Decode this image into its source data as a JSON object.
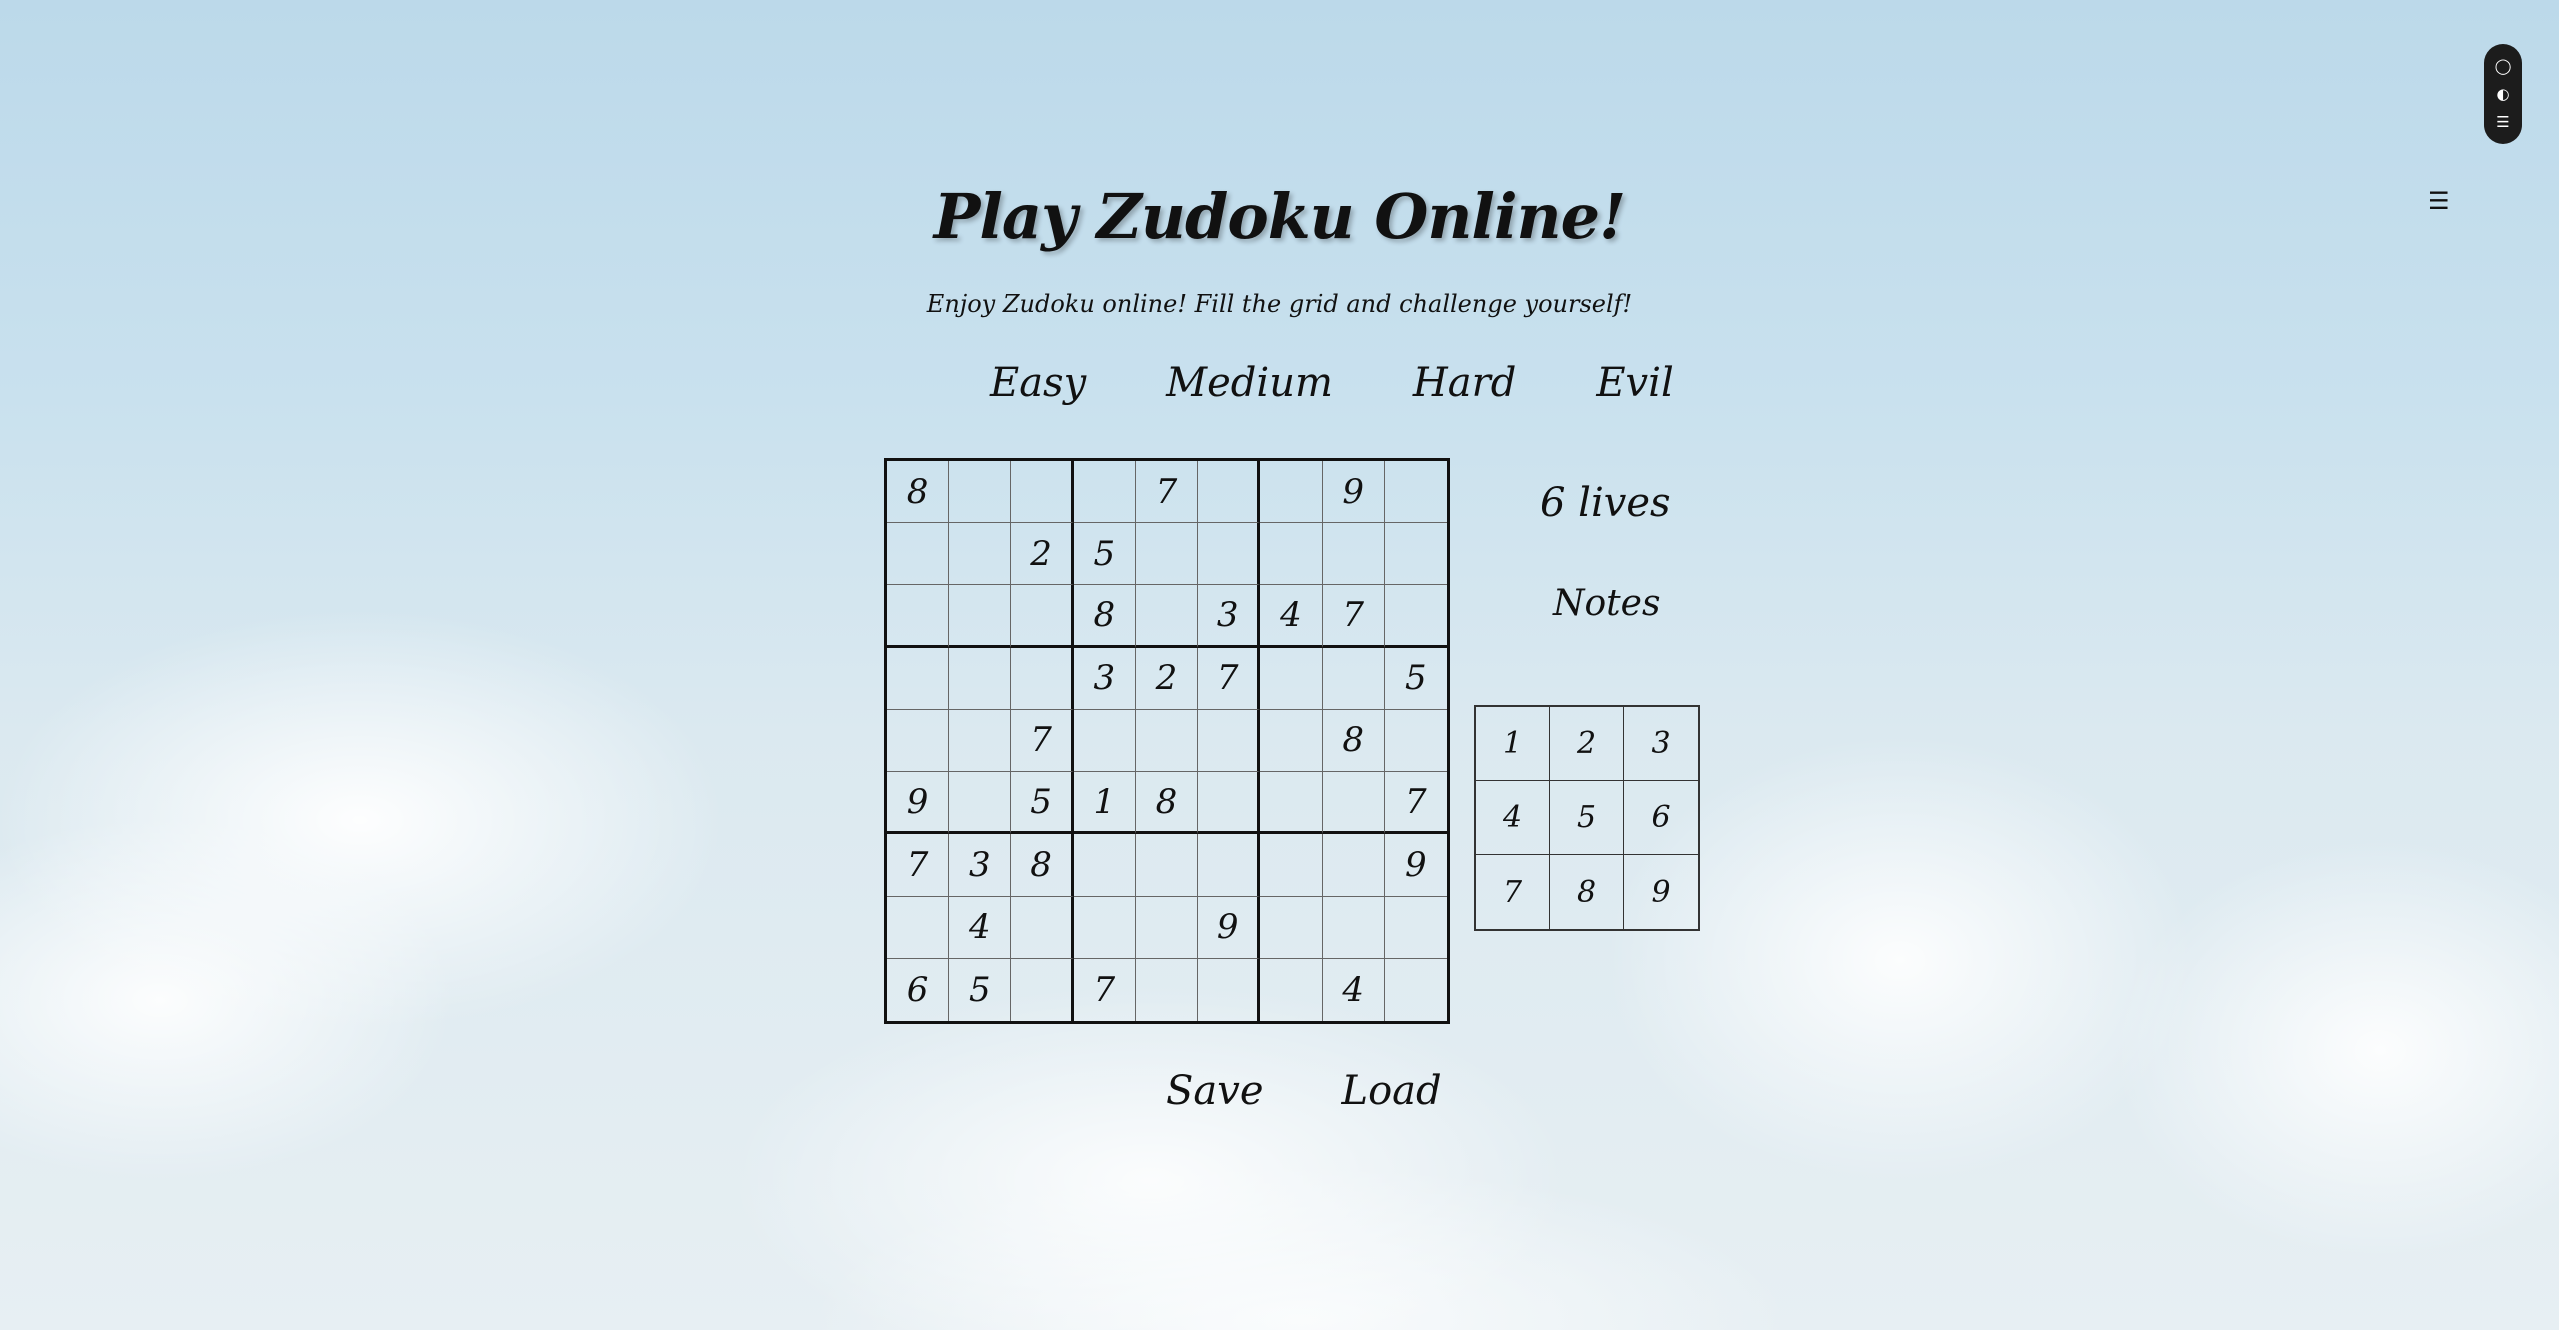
{
  "title": "Play Zudoku Online!",
  "subtitle": "Enjoy Zudoku online! Fill the grid and challenge yourself!",
  "levels": [
    "Easy",
    "Medium",
    "Hard",
    "Evil"
  ],
  "board": [
    [
      "8",
      "",
      "",
      "",
      "7",
      "",
      "",
      "9",
      ""
    ],
    [
      "",
      "",
      "2",
      "5",
      "",
      "",
      "",
      "",
      ""
    ],
    [
      "",
      "",
      "",
      "8",
      "",
      "3",
      "4",
      "7",
      ""
    ],
    [
      "",
      "",
      "",
      "3",
      "2",
      "7",
      "",
      "",
      "5"
    ],
    [
      "",
      "",
      "7",
      "",
      "",
      "",
      "",
      "8",
      ""
    ],
    [
      "9",
      "",
      "5",
      "1",
      "8",
      "",
      "",
      "",
      "7"
    ],
    [
      "7",
      "3",
      "8",
      "",
      "",
      "",
      "",
      "",
      "9"
    ],
    [
      "",
      "4",
      "",
      "",
      "",
      "9",
      "",
      "",
      ""
    ],
    [
      "6",
      "5",
      "",
      "7",
      "",
      "",
      "",
      "4",
      ""
    ]
  ],
  "lives_label": "6 lives",
  "notes_label": "Notes",
  "numpad": [
    "1",
    "2",
    "3",
    "4",
    "5",
    "6",
    "7",
    "8",
    "9"
  ],
  "actions": {
    "save": "Save",
    "load": "Load"
  },
  "menu_icon": "hamburger-icon",
  "side_icons": [
    "chat-icon",
    "toggle-icon",
    "list-icon"
  ]
}
